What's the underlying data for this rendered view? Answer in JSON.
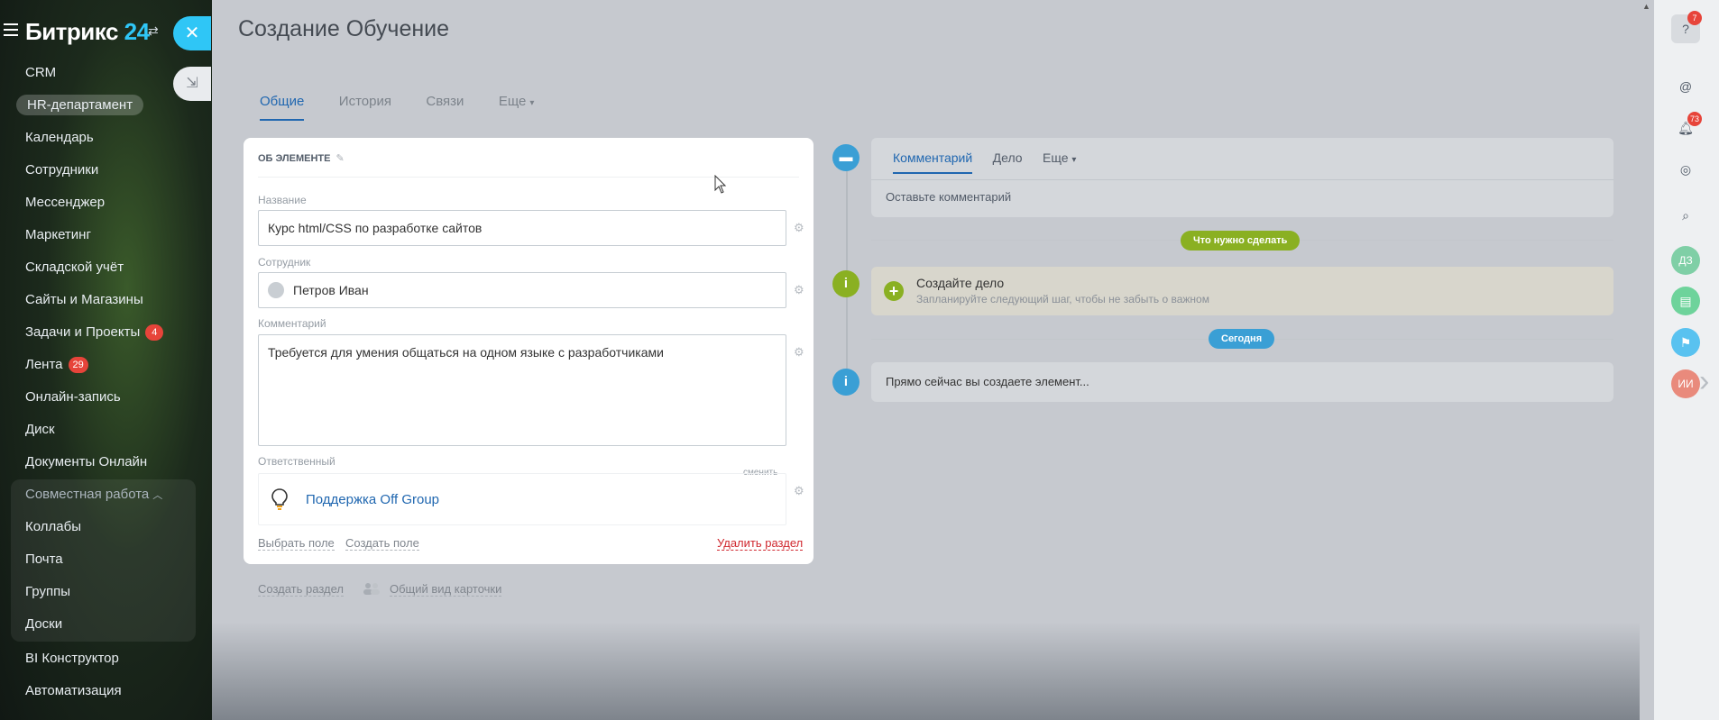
{
  "app": {
    "logo_text": "Битрикс",
    "logo_number": "24"
  },
  "sidebar": {
    "items": [
      {
        "label": "CRM"
      },
      {
        "label": "HR-департамент",
        "active": true
      },
      {
        "label": "Календарь"
      },
      {
        "label": "Сотрудники"
      },
      {
        "label": "Мессенджер"
      },
      {
        "label": "Маркетинг"
      },
      {
        "label": "Складской учёт"
      },
      {
        "label": "Сайты и Магазины"
      },
      {
        "label": "Задачи и Проекты",
        "badge": "4"
      },
      {
        "label": "Лента",
        "badge": "29"
      },
      {
        "label": "Онлайн-запись"
      },
      {
        "label": "Диск"
      },
      {
        "label": "Документы Онлайн"
      }
    ],
    "group": {
      "title": "Совместная работа",
      "items": [
        {
          "label": "Коллабы"
        },
        {
          "label": "Почта"
        },
        {
          "label": "Группы"
        },
        {
          "label": "Доски"
        }
      ]
    },
    "bottom_items": [
      {
        "label": "BI Конструктор"
      },
      {
        "label": "Автоматизация"
      }
    ]
  },
  "page": {
    "title": "Создание Обучение",
    "tabs": [
      {
        "label": "Общие",
        "active": true
      },
      {
        "label": "История"
      },
      {
        "label": "Связи"
      },
      {
        "label": "Еще"
      }
    ]
  },
  "card": {
    "header": "ОБ ЭЛЕМЕНТЕ",
    "fields": {
      "name": {
        "label": "Название",
        "value": "Курс html/CSS по разработке сайтов"
      },
      "employee": {
        "label": "Сотрудник",
        "value": "Петров Иван"
      },
      "comment": {
        "label": "Комментарий",
        "value": "Требуется для умения общаться на одном языке с разработчиками"
      },
      "responsible": {
        "label": "Ответственный",
        "change": "сменить",
        "value": "Поддержка Off Group"
      }
    },
    "links": {
      "select_field": "Выбрать поле",
      "create_field": "Создать поле",
      "delete_section": "Удалить раздел"
    }
  },
  "below": {
    "create_section": "Создать раздел",
    "card_view": "Общий вид карточки"
  },
  "timeline": {
    "composer": {
      "tabs": [
        {
          "label": "Комментарий",
          "active": true
        },
        {
          "label": "Дело"
        },
        {
          "label": "Еще"
        }
      ],
      "placeholder": "Оставьте комментарий"
    },
    "todo_pill": "Что нужно сделать",
    "todo": {
      "title": "Создайте дело",
      "subtitle": "Запланируйте следующий шаг, чтобы не забыть о важном"
    },
    "today_pill": "Сегодня",
    "now": "Прямо сейчас вы создаете элемент..."
  },
  "rightbar": {
    "help_badge": "7",
    "notifications_badge": "73",
    "avatars": [
      {
        "initials": "ДЗ"
      },
      {
        "initials": "ИИ"
      }
    ]
  },
  "colors": {
    "accent": "#2fc6f6",
    "link": "#2067b0",
    "danger": "#d0282f",
    "green": "#8ab022",
    "pill_blue": "#3a9fd5"
  }
}
